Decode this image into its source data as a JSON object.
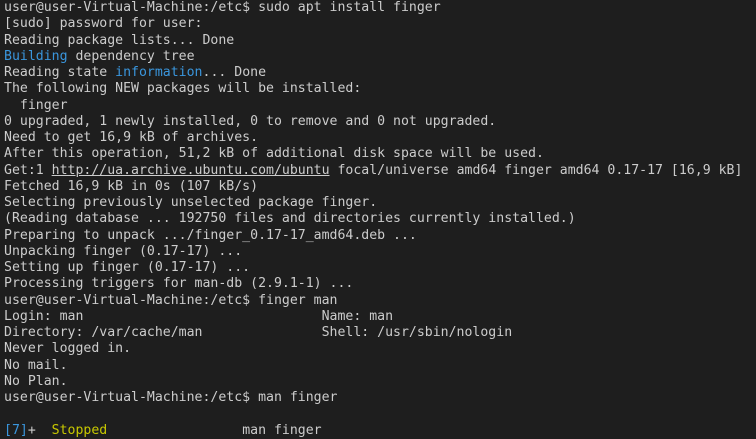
{
  "colors": {
    "background": "#1e1e1e",
    "text": "#cccccc",
    "blue": "#3a96dd",
    "yellow": "#c8c800"
  },
  "lines": [
    [
      {
        "t": "user@user-Virtual-Machine:/etc$ sudo apt install finger"
      }
    ],
    [
      {
        "t": "[sudo] password for user:"
      }
    ],
    [
      {
        "t": "Reading package lists... Done"
      }
    ],
    [
      {
        "t": "Building",
        "c": "blue"
      },
      {
        "t": " dependency tree"
      }
    ],
    [
      {
        "t": "Reading state "
      },
      {
        "t": "information",
        "c": "blue"
      },
      {
        "t": "... Done"
      }
    ],
    [
      {
        "t": "The following NEW packages will be installed:"
      }
    ],
    [
      {
        "t": "  finger"
      }
    ],
    [
      {
        "t": "0 upgraded, 1 newly installed, 0 to remove and 0 not upgraded."
      }
    ],
    [
      {
        "t": "Need to get 16,9 kB of archives."
      }
    ],
    [
      {
        "t": "After this operation, 51,2 kB of additional disk space will be used."
      }
    ],
    [
      {
        "t": "Get:1 "
      },
      {
        "t": "http://ua.archive.ubuntu.com/ubuntu",
        "c": "link"
      },
      {
        "t": " focal/universe amd64 finger amd64 0.17-17 [16,9 kB]"
      }
    ],
    [
      {
        "t": "Fetched 16,9 kB in 0s (107 kB/s)"
      }
    ],
    [
      {
        "t": "Selecting previously unselected package finger."
      }
    ],
    [
      {
        "t": "(Reading database ... 192750 files and directories currently installed.)"
      }
    ],
    [
      {
        "t": "Preparing to unpack .../finger_0.17-17_amd64.deb ..."
      }
    ],
    [
      {
        "t": "Unpacking finger (0.17-17) ..."
      }
    ],
    [
      {
        "t": "Setting up finger (0.17-17) ..."
      }
    ],
    [
      {
        "t": "Processing triggers for man-db (2.9.1-1) ..."
      }
    ],
    [
      {
        "t": "user@user-Virtual-Machine:/etc$ finger man"
      }
    ],
    [
      {
        "t": "Login: man                              Name: man"
      }
    ],
    [
      {
        "t": "Directory: /var/cache/man               Shell: /usr/sbin/nologin"
      }
    ],
    [
      {
        "t": "Never logged in."
      }
    ],
    [
      {
        "t": "No mail."
      }
    ],
    [
      {
        "t": "No Plan."
      }
    ],
    [
      {
        "t": "user@user-Virtual-Machine:/etc$ man finger"
      }
    ],
    [
      {
        "t": ""
      }
    ],
    [
      {
        "t": "[7]",
        "c": "blue"
      },
      {
        "t": "+  "
      },
      {
        "t": "Stopped",
        "c": "yellow"
      },
      {
        "t": "                 man finger"
      }
    ]
  ]
}
